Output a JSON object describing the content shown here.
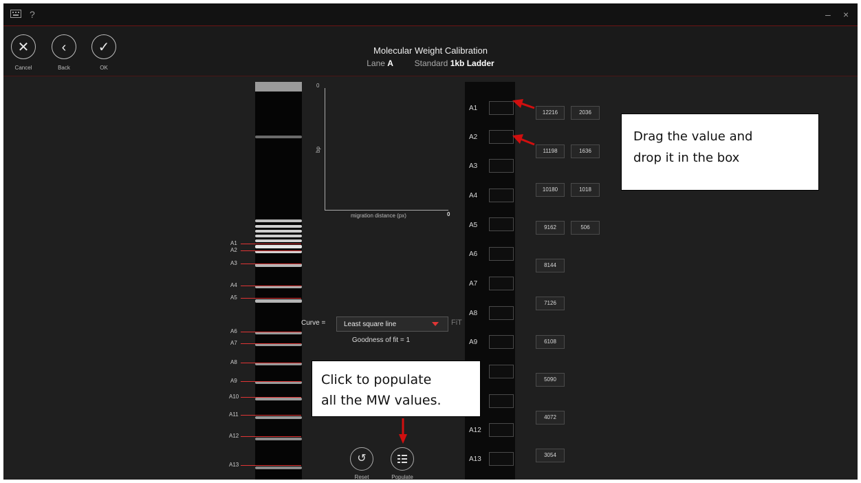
{
  "topbar": {
    "keyboard_icon": "keyboard-icon",
    "help_label": "?",
    "minimize_label": "–",
    "close_label": "×"
  },
  "header": {
    "cancel_label": "Cancel",
    "back_label": "Back",
    "ok_label": "OK",
    "title": "Molecular Weight Calibration",
    "lane_label": "Lane",
    "lane_value": "A",
    "standard_label": "Standard",
    "standard_value": "1kb Ladder"
  },
  "lanes": [
    "A1",
    "A2",
    "A3",
    "A4",
    "A5",
    "A6",
    "A7",
    "A8",
    "A9",
    "A10",
    "A11",
    "A12",
    "A13"
  ],
  "plot": {
    "y_top": "0",
    "y_label": "bp",
    "x_label": "migration distance (px)",
    "x_zero": "0"
  },
  "curve": {
    "label": "Curve =",
    "selected": "Least square line",
    "fit_label": "FiT",
    "goodness": "Goodness of fit = 1"
  },
  "controls": {
    "reset_label": "Reset",
    "populate_label": "Populate"
  },
  "slots": [
    "A1",
    "A2",
    "A3",
    "A4",
    "A5",
    "A6",
    "A7",
    "A8",
    "A9",
    "",
    "",
    "A12",
    "A13"
  ],
  "values_col1": [
    "12216",
    "11198",
    "10180",
    "9162",
    "8144",
    "7126",
    "6108",
    "5090",
    "4072",
    "3054"
  ],
  "values_col2": [
    "2036",
    "1636",
    "1018",
    "506"
  ],
  "callouts": {
    "drag_line1": "Drag the value and",
    "drag_line2": "drop it in the box",
    "populate_line1": "Click to populate",
    "populate_line2": "all the MW values."
  },
  "colors": {
    "accent": "#e03535",
    "background": "#1f1f1f",
    "annotation_arrow": "#d10f0f"
  }
}
